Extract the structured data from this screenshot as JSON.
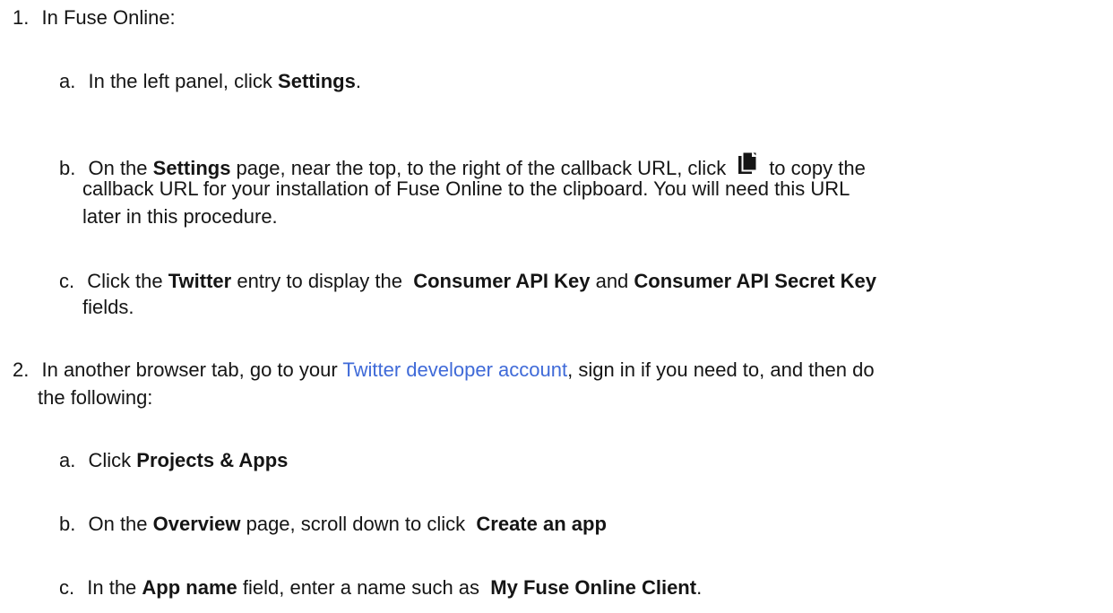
{
  "step1": {
    "marker": "1.",
    "text": "In Fuse Online:",
    "a": {
      "marker": "a.",
      "t1": "In the left panel, click ",
      "bold1": "Settings",
      "t2": "."
    },
    "b": {
      "marker": "b.",
      "t1": "On the ",
      "bold1": "Settings",
      "t2": " page, near the top, to the right of the callback URL, click",
      "icon": "copy-icon",
      "t3": "to copy the",
      "line2": "callback URL for your installation of Fuse Online to the clipboard. You will need this URL",
      "line3": "later in this procedure."
    },
    "c": {
      "marker": "c.",
      "t1": "Click the ",
      "bold1": "Twitter",
      "t2": " entry to display the  ",
      "bold2": "Consumer API Key",
      "t3": " and ",
      "bold3": "Consumer API Secret Key",
      "line2": "fields."
    }
  },
  "step2": {
    "marker": "2.",
    "t1": "In another browser tab, go to your ",
    "link": "Twitter developer account",
    "t2": ", sign in if you need to, and then do",
    "line2": "the following:",
    "a": {
      "marker": "a.",
      "t1": "Click ",
      "bold1": "Projects & Apps"
    },
    "b": {
      "marker": "b.",
      "t1": "On the ",
      "bold1": "Overview",
      "t2": " page, scroll down to click  ",
      "bold2": "Create an app"
    },
    "c": {
      "marker": "c.",
      "t1": "In the ",
      "bold1": "App name",
      "t2": " field, enter a name such as  ",
      "bold2": "My Fuse Online Client",
      "t3": "."
    }
  }
}
